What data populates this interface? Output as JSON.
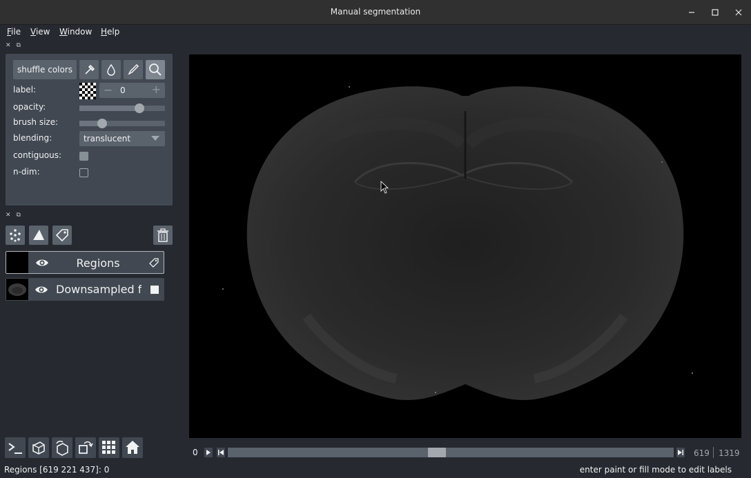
{
  "window": {
    "title": "Manual segmentation",
    "minimize_icon": "minimize-icon",
    "maximize_icon": "maximize-icon",
    "close_icon": "close-icon"
  },
  "menu": {
    "items": [
      {
        "label": "File",
        "underline": "F",
        "rest": "ile"
      },
      {
        "label": "View",
        "underline": "V",
        "rest": "iew"
      },
      {
        "label": "Window",
        "underline": "W",
        "rest": "indow"
      },
      {
        "label": "Help",
        "underline": "H",
        "rest": "elp"
      }
    ]
  },
  "layer_controls": {
    "shuffle_colors": "shuffle colors",
    "tools": [
      "picker-icon",
      "fill-icon",
      "paint-icon",
      "zoom-icon"
    ],
    "active_tool": "zoom-icon",
    "label_label": "label:",
    "label_value": "0",
    "label_minus": "−",
    "label_plus": "+",
    "opacity_label": "opacity:",
    "opacity_value": 0.7,
    "brush_size_label": "brush size:",
    "brush_size_value": 0.27,
    "blending_label": "blending:",
    "blending_value": "translucent",
    "contiguous_label": "contiguous:",
    "contiguous_checked": true,
    "ndim_label": "n-dim:",
    "ndim_checked": false
  },
  "layer_buttons": [
    "new-points-icon",
    "new-shapes-icon",
    "new-labels-icon",
    "delete-layer-icon"
  ],
  "layers": [
    {
      "name": "Regions",
      "type_icon": "labels-icon",
      "visible": true,
      "selected": true
    },
    {
      "name": "Downsampled fill",
      "type_icon": "image-icon",
      "visible": true,
      "selected": false
    }
  ],
  "console_buttons": [
    "console-icon",
    "ndisplay-icon",
    "roll-icon",
    "transpose-icon",
    "grid-icon",
    "home-icon"
  ],
  "dims": {
    "axis_index": "0",
    "current": "619",
    "total": "1319",
    "position_fraction": 0.469
  },
  "status": {
    "left": "Regions [619 221 437]: 0",
    "right": "enter paint or fill mode to edit labels"
  },
  "colors": {
    "background": "#262930",
    "panel": "#414851",
    "button": "#5a626c",
    "text": "#f0f1f2"
  }
}
